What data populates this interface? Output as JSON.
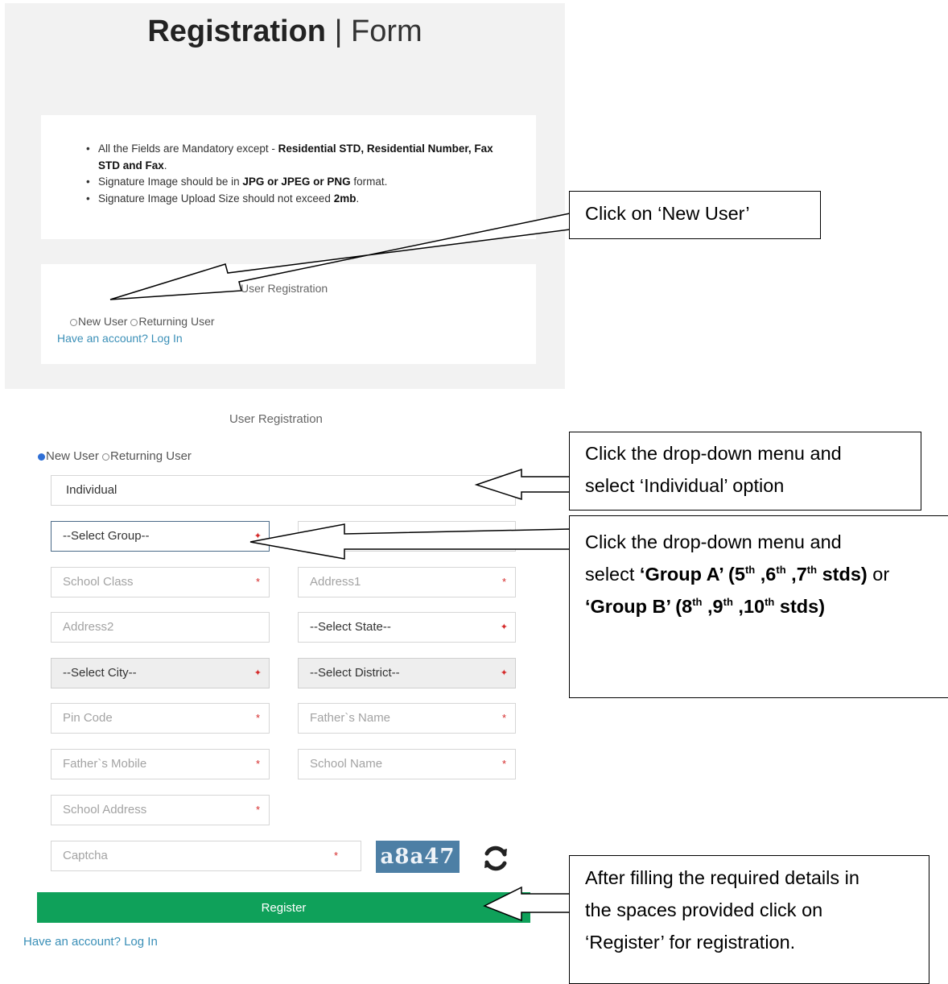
{
  "header": {
    "title_bold": "Registration",
    "title_sep": "|",
    "title_thin": "Form"
  },
  "instructions": {
    "item1_prefix": "All the Fields are Mandatory except - ",
    "item1_bold": "Residential STD, Residential Number, Fax STD and Fax",
    "item1_suffix": ".",
    "item2_prefix": "Signature Image should be in ",
    "item2_bold": "JPG or JPEG or PNG",
    "item2_suffix": " format.",
    "item3_prefix": "Signature Image Upload Size should not exceed ",
    "item3_bold": "2mb",
    "item3_suffix": "."
  },
  "registration_top": {
    "section_title": "User Registration",
    "radio_new": "New User",
    "radio_returning": "Returning User",
    "login_link": "Have an account? Log In"
  },
  "registration_form": {
    "section_title": "User Registration",
    "radio_new": "New User",
    "radio_returning": "Returning User",
    "user_type": "Individual",
    "group_select": "--Select Group--",
    "school_class": "School Class",
    "address1": "Address1",
    "address2": "Address2",
    "state_select": "--Select State--",
    "city_select": "--Select City--",
    "district_select": "--Select District--",
    "pin_code": "Pin Code",
    "father_name": "Father`s Name",
    "father_mobile": "Father`s Mobile",
    "school_name": "School Name",
    "school_address": "School Address",
    "captcha_placeholder": "Captcha",
    "captcha_text": "a8a47",
    "required_mark": "*",
    "register_label": "Register",
    "login_link": "Have an account? Log In"
  },
  "annotations": {
    "new_user": "Click on ‘New User’",
    "individual_line1": "Click the drop-down menu and",
    "individual_line2": "select ‘Individual’ option",
    "group_line1": "Click the drop-down menu and",
    "group_line2_prefix": "select ",
    "group_a_pre": "‘Group A’ (5",
    "th": "th",
    "comma": " ,",
    "n6": "6",
    "n7": "7",
    "stds": " stds)",
    "or": " or",
    "group_b_pre": "‘Group B’ (8",
    "n9": "9",
    "n10": "10",
    "register_line1": "After filling the required details in",
    "register_line2": "the spaces provided click on",
    "register_line3": "‘Register’ for registration."
  },
  "colors": {
    "register_button": "#0fa15a",
    "link": "#3a8fb7",
    "required": "#d52b2b",
    "captcha_bg": "#4d7fa5"
  }
}
